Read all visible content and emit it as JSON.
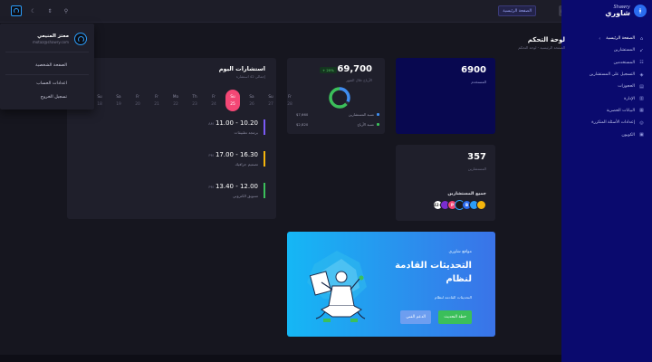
{
  "topbar": {
    "home_label": "الصفحة الرئيسية"
  },
  "sidebar": {
    "brand_sub": "Shawry",
    "brand_name": "شاوري",
    "items": [
      {
        "label": "الصفحة الرئيسية",
        "icon": "home-icon"
      },
      {
        "label": "المستشارين",
        "icon": "rocket-icon"
      },
      {
        "label": "المستخدمين",
        "icon": "users-icon"
      },
      {
        "label": "التسجيل على المستشارين",
        "icon": "layers-icon"
      },
      {
        "label": "الحجوزات",
        "icon": "calendar-icon"
      },
      {
        "label": "الإدارة",
        "icon": "building-icon"
      },
      {
        "label": "البيانات الحصرية",
        "icon": "database-icon"
      },
      {
        "label": "إعدادات الأسئلة المتكررة",
        "icon": "question-icon"
      },
      {
        "label": "الكوبون",
        "icon": "coupon-icon"
      }
    ]
  },
  "user_menu": {
    "name": "معتز المنيعي",
    "email": "motaz@shawry.com",
    "items": [
      "الصفحة الشخصية",
      "اعدادات الحساب",
      "تسجيل الخروج"
    ]
  },
  "page": {
    "title": "لوحة التحكم",
    "breadcrumb": "الصفحة الرئيسية - لوحة التحكم"
  },
  "stats_users": {
    "value": "6900",
    "label": "المستخدم"
  },
  "stats_revenue": {
    "value": "69,700",
    "badge": "+ 20%",
    "sub": "الأرباح خلال الشهر",
    "legend": [
      {
        "label": "نسبة المستشارين",
        "value": "$7,660",
        "color": "#3f8df0"
      },
      {
        "label": "نسبة الأرباح",
        "value": "$2,820",
        "color": "#3bbf5a"
      }
    ]
  },
  "stats_consultants": {
    "value": "357",
    "label": "المستشارين",
    "title": "جميع المستشارين",
    "avatars": [
      {
        "text": "",
        "color": "#f5b50c"
      },
      {
        "text": "",
        "color": "#2b9cf8"
      },
      {
        "text": "B",
        "color": "#2a6cf0"
      },
      {
        "text": "",
        "color": "#1a1a1a"
      },
      {
        "text": "P",
        "color": "#f34775"
      },
      {
        "text": "",
        "color": "#7a2dd0"
      },
      {
        "text": "42+",
        "color": "#ffffff"
      }
    ]
  },
  "calendar": {
    "title": "استشارات اليوم",
    "sub": "إجمالي 42 استشارة",
    "days": [
      {
        "name": "Su",
        "date": "18"
      },
      {
        "name": "Sa",
        "date": "19"
      },
      {
        "name": "Fr",
        "date": "20"
      },
      {
        "name": "Fr",
        "date": "21"
      },
      {
        "name": "Mo",
        "date": "22"
      },
      {
        "name": "Th",
        "date": "23"
      },
      {
        "name": "Fr",
        "date": "24"
      },
      {
        "name": "Su",
        "date": "25"
      },
      {
        "name": "Sa",
        "date": "26"
      },
      {
        "name": "Su",
        "date": "27"
      },
      {
        "name": "Fr",
        "date": "28"
      }
    ],
    "today_index": 7,
    "slots": [
      {
        "time": "11.00 - 10.20",
        "period": "AM",
        "title": "برمجة تطبيقات",
        "color": "#7a5af5"
      },
      {
        "time": "17.00 - 16.30",
        "period": "PM",
        "title": "تصميم جرافيك",
        "color": "#f5b50c"
      },
      {
        "time": "13.40 - 12.00",
        "period": "PM",
        "title": "تسويق الكتروني",
        "color": "#3bbf5a"
      }
    ]
  },
  "promo": {
    "tag": "مواقع شاوري",
    "headline_1": "التحديثات القادمة",
    "headline_2": "لنظام",
    "desc": "التحديثات القادمة لنظام",
    "btn_primary": "خطة التحديث",
    "btn_secondary": "الدعم الفني"
  }
}
